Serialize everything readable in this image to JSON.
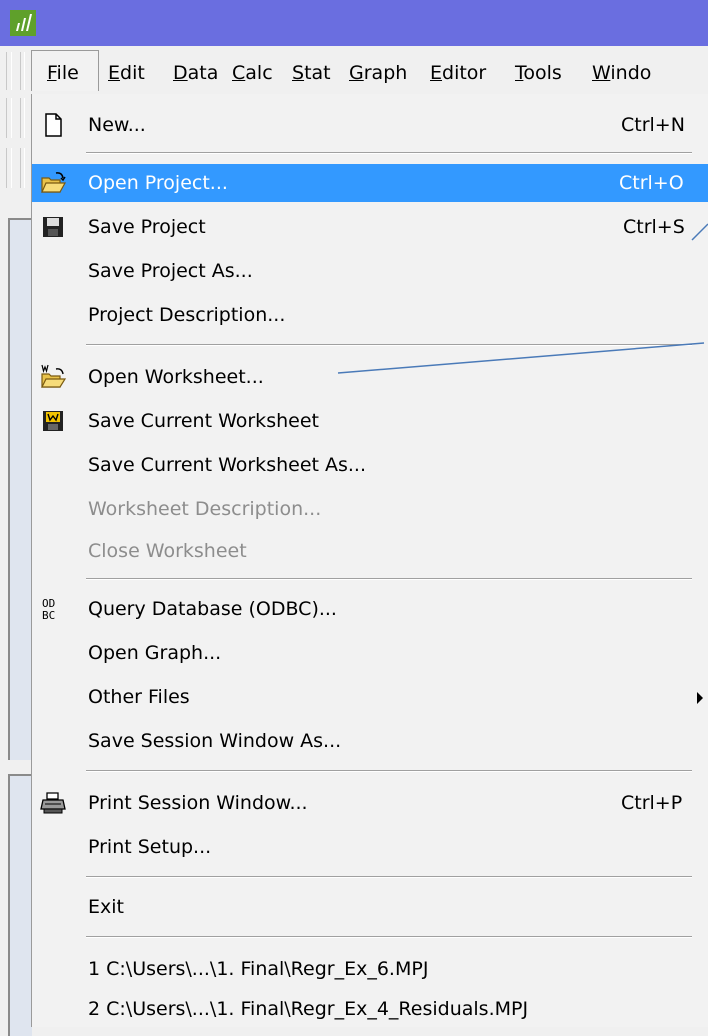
{
  "menubar": {
    "items": [
      {
        "label": "File"
      },
      {
        "label": "Edit"
      },
      {
        "label": "Data"
      },
      {
        "label": "Calc"
      },
      {
        "label": "Stat"
      },
      {
        "label": "Graph"
      },
      {
        "label": "Editor"
      },
      {
        "label": "Tools"
      },
      {
        "label": "Windo"
      }
    ]
  },
  "file_menu": {
    "items": [
      {
        "label": "New...",
        "shortcut": "Ctrl+N",
        "icon": "new-document-icon"
      },
      {
        "label": "Open Project...",
        "shortcut": "Ctrl+O",
        "icon": "open-folder-icon",
        "highlighted": true
      },
      {
        "label": "Save Project",
        "shortcut": "Ctrl+S",
        "icon": "floppy-disk-icon"
      },
      {
        "label": "Save Project As..."
      },
      {
        "label": "Project Description..."
      },
      {
        "label": "Open Worksheet...",
        "icon": "open-worksheet-icon"
      },
      {
        "label": "Save Current Worksheet",
        "icon": "save-worksheet-icon"
      },
      {
        "label": "Save Current Worksheet As..."
      },
      {
        "label": "Worksheet Description...",
        "disabled": true
      },
      {
        "label": "Close Worksheet",
        "disabled": true
      },
      {
        "label": "Query Database (ODBC)...",
        "icon": "odbc-icon"
      },
      {
        "label": "Open Graph..."
      },
      {
        "label": "Other Files",
        "submenu": true
      },
      {
        "label": "Save Session Window As..."
      },
      {
        "label": "Print Session Window...",
        "shortcut": "Ctrl+P",
        "icon": "printer-icon"
      },
      {
        "label": "Print Setup..."
      },
      {
        "label": "Exit"
      },
      {
        "label": "1 C:\\Users\\...\\1. Final\\Regr_Ex_6.MPJ"
      },
      {
        "label": "2 C:\\Users\\...\\1. Final\\Regr_Ex_4_Residuals.MPJ"
      }
    ]
  },
  "icon_text": {
    "odbc": "OD\nBC"
  },
  "colors": {
    "titlebar": "#6a6ee0",
    "highlight": "#3399ff",
    "disabled_text": "#8d8d8d"
  }
}
